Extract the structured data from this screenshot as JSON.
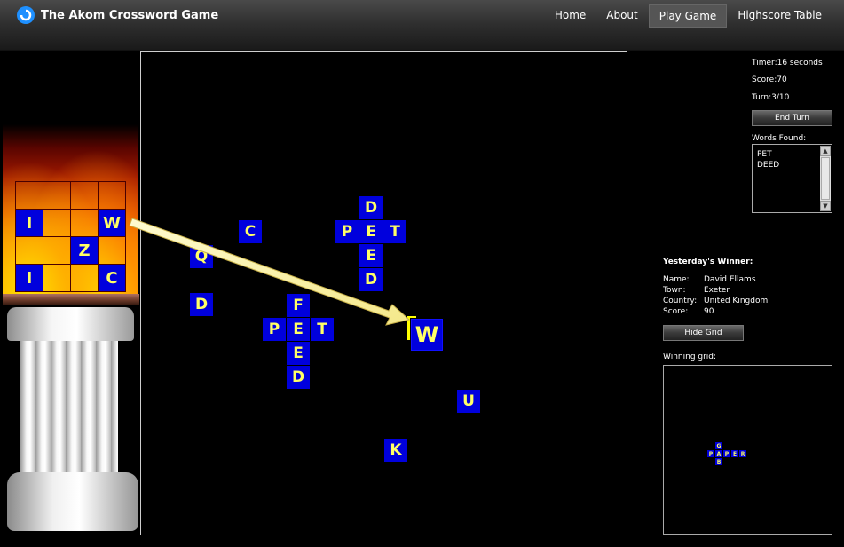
{
  "header": {
    "app_title": "The Akom Crossword Game",
    "nav": [
      {
        "label": "Home",
        "active": false
      },
      {
        "label": "About",
        "active": false
      },
      {
        "label": "Play Game",
        "active": true
      },
      {
        "label": "Highscore Table",
        "active": false
      }
    ]
  },
  "rack": {
    "rows": [
      [
        "",
        "",
        "",
        ""
      ],
      [
        "I",
        "",
        "",
        "W"
      ],
      [
        "",
        "",
        "Z",
        ""
      ],
      [
        "I",
        "",
        "",
        "C"
      ]
    ]
  },
  "board": {
    "tiles": [
      "C",
      "Q",
      "D",
      "D",
      "P",
      "E",
      "T",
      "E",
      "D",
      "F",
      "P",
      "E",
      "T",
      "E",
      "D",
      "U",
      "K"
    ],
    "placed_tile": "W"
  },
  "status": {
    "timer_label": "Timer:",
    "timer_value": "16 seconds",
    "score_label": "Score:",
    "score_value": "70",
    "turn_label": "Turn:",
    "turn_value": "3/10",
    "end_turn_label": "End Turn",
    "words_found_label": "Words Found:",
    "words_found": [
      "PET",
      "DEED"
    ]
  },
  "winner": {
    "title": "Yesterday's Winner:",
    "name_label": "Name:",
    "name_value": "David Ellams",
    "town_label": "Town:",
    "town_value": "Exeter",
    "country_label": "Country:",
    "country_value": "United Kingdom",
    "score_label": "Score:",
    "score_value": "90",
    "hide_grid_label": "Hide Grid",
    "winning_grid_label": "Winning grid:",
    "winning_grid_tiles": [
      "G",
      "P",
      "A",
      "P",
      "E",
      "R",
      "B"
    ]
  },
  "colors": {
    "tile_bg": "#0000dd",
    "tile_text": "#ffff66",
    "arrow": "#ffffb0"
  }
}
